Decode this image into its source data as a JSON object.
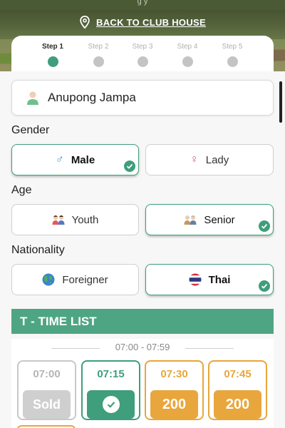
{
  "header": {
    "caption": "g   y",
    "back_label": "BACK TO CLUB HOUSE"
  },
  "steps": [
    {
      "label": "Step 1",
      "active": true
    },
    {
      "label": "Step 2",
      "active": false
    },
    {
      "label": "Step 3",
      "active": false
    },
    {
      "label": "Step 4",
      "active": false
    },
    {
      "label": "Step 5",
      "active": false
    }
  ],
  "player": {
    "name": "Anupong Jampa"
  },
  "gender": {
    "title": "Gender",
    "options": [
      {
        "label": "Male",
        "icon": "male-symbol-icon",
        "selected": true
      },
      {
        "label": "Lady",
        "icon": "female-symbol-icon",
        "selected": false
      }
    ]
  },
  "age": {
    "title": "Age",
    "options": [
      {
        "label": "Youth",
        "icon": "youth-icon",
        "selected": false
      },
      {
        "label": "Senior",
        "icon": "senior-icon",
        "selected": true
      }
    ]
  },
  "nationality": {
    "title": "Nationality",
    "options": [
      {
        "label": "Foreigner",
        "icon": "globe-icon",
        "selected": false
      },
      {
        "label": "Thai",
        "icon": "thai-flag-icon",
        "selected": true
      }
    ]
  },
  "ttime": {
    "title": "T - TIME LIST",
    "range": "07:00 - 07:59",
    "slots": [
      {
        "time": "07:00",
        "status": "Sold"
      },
      {
        "time": "07:15",
        "status": "selected"
      },
      {
        "time": "07:30",
        "status": "200"
      },
      {
        "time": "07:45",
        "status": "200"
      }
    ]
  },
  "colors": {
    "accent": "#3f9e7b",
    "header_bar": "#4ea583",
    "available": "#e8a63c",
    "sold": "#cfcfcf"
  }
}
